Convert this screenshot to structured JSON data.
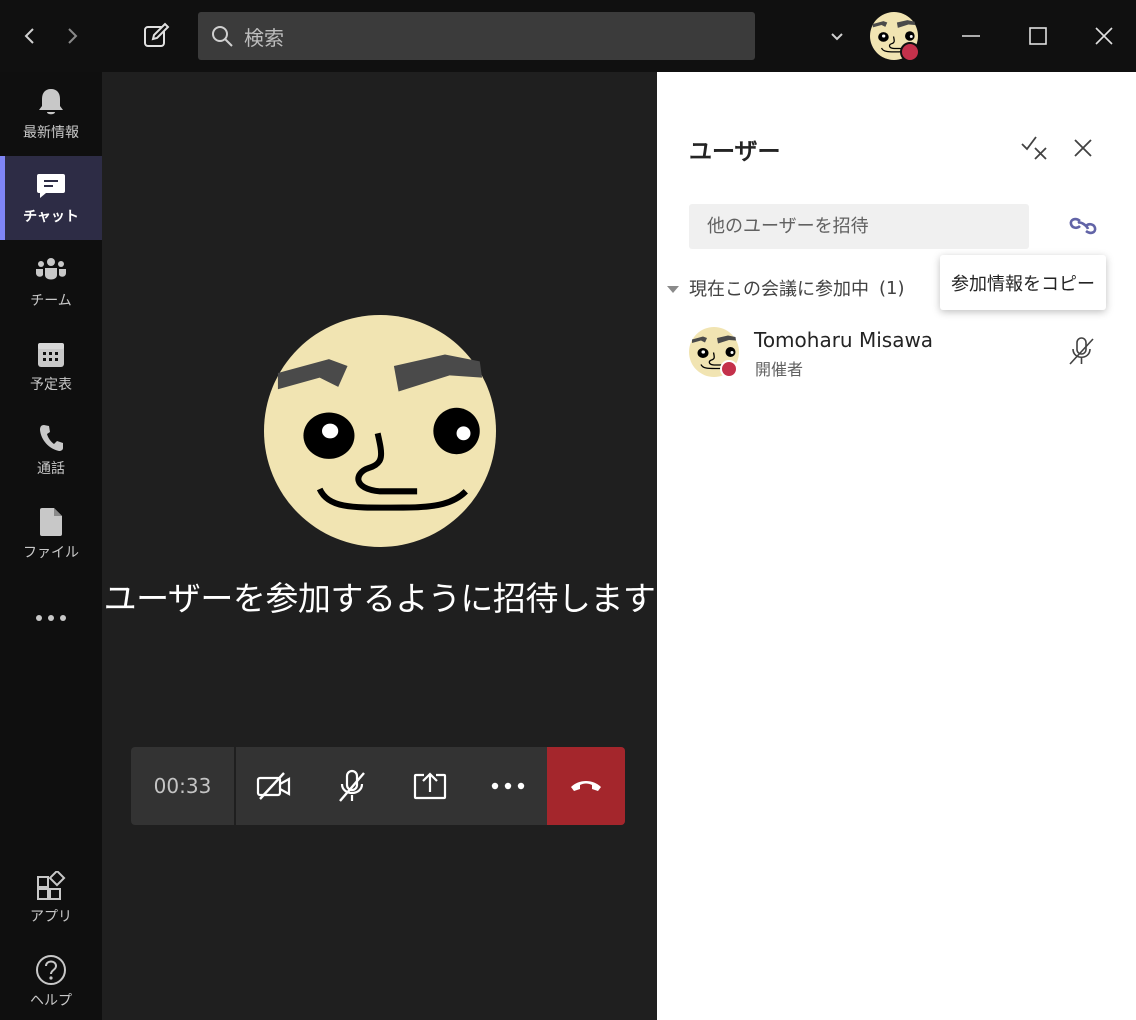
{
  "titlebar": {
    "search_placeholder": "検索",
    "icons": [
      "back-icon",
      "forward-icon",
      "compose-icon",
      "search-icon",
      "chevron-down-icon",
      "minimize-icon",
      "maximize-icon",
      "close-icon"
    ]
  },
  "rail": {
    "items": [
      {
        "label": "最新情報",
        "icon": "bell-icon"
      },
      {
        "label": "チャット",
        "icon": "chat-icon",
        "active": true
      },
      {
        "label": "チーム",
        "icon": "teams-icon"
      },
      {
        "label": "予定表",
        "icon": "calendar-icon"
      },
      {
        "label": "通話",
        "icon": "phone-icon"
      },
      {
        "label": "ファイル",
        "icon": "file-icon"
      },
      {
        "label": "アプリ",
        "icon": "apps-icon"
      },
      {
        "label": "ヘルプ",
        "icon": "help-icon"
      }
    ]
  },
  "stage": {
    "invite_text": "ユーザーを参加するように招待します",
    "timer": "00:33"
  },
  "panel": {
    "title": "ユーザー",
    "invite_placeholder": "他のユーザーを招待",
    "tooltip": "参加情報をコピー",
    "section_label": "現在この会議に参加中",
    "section_count": "(1)",
    "participant": {
      "name": "Tomoharu Misawa",
      "role": "開催者"
    }
  },
  "colors": {
    "accent": "#7f85f5",
    "hangup": "#a4262c",
    "status_busy": "#c4314b",
    "avatar_face": "#f1e4b2"
  }
}
